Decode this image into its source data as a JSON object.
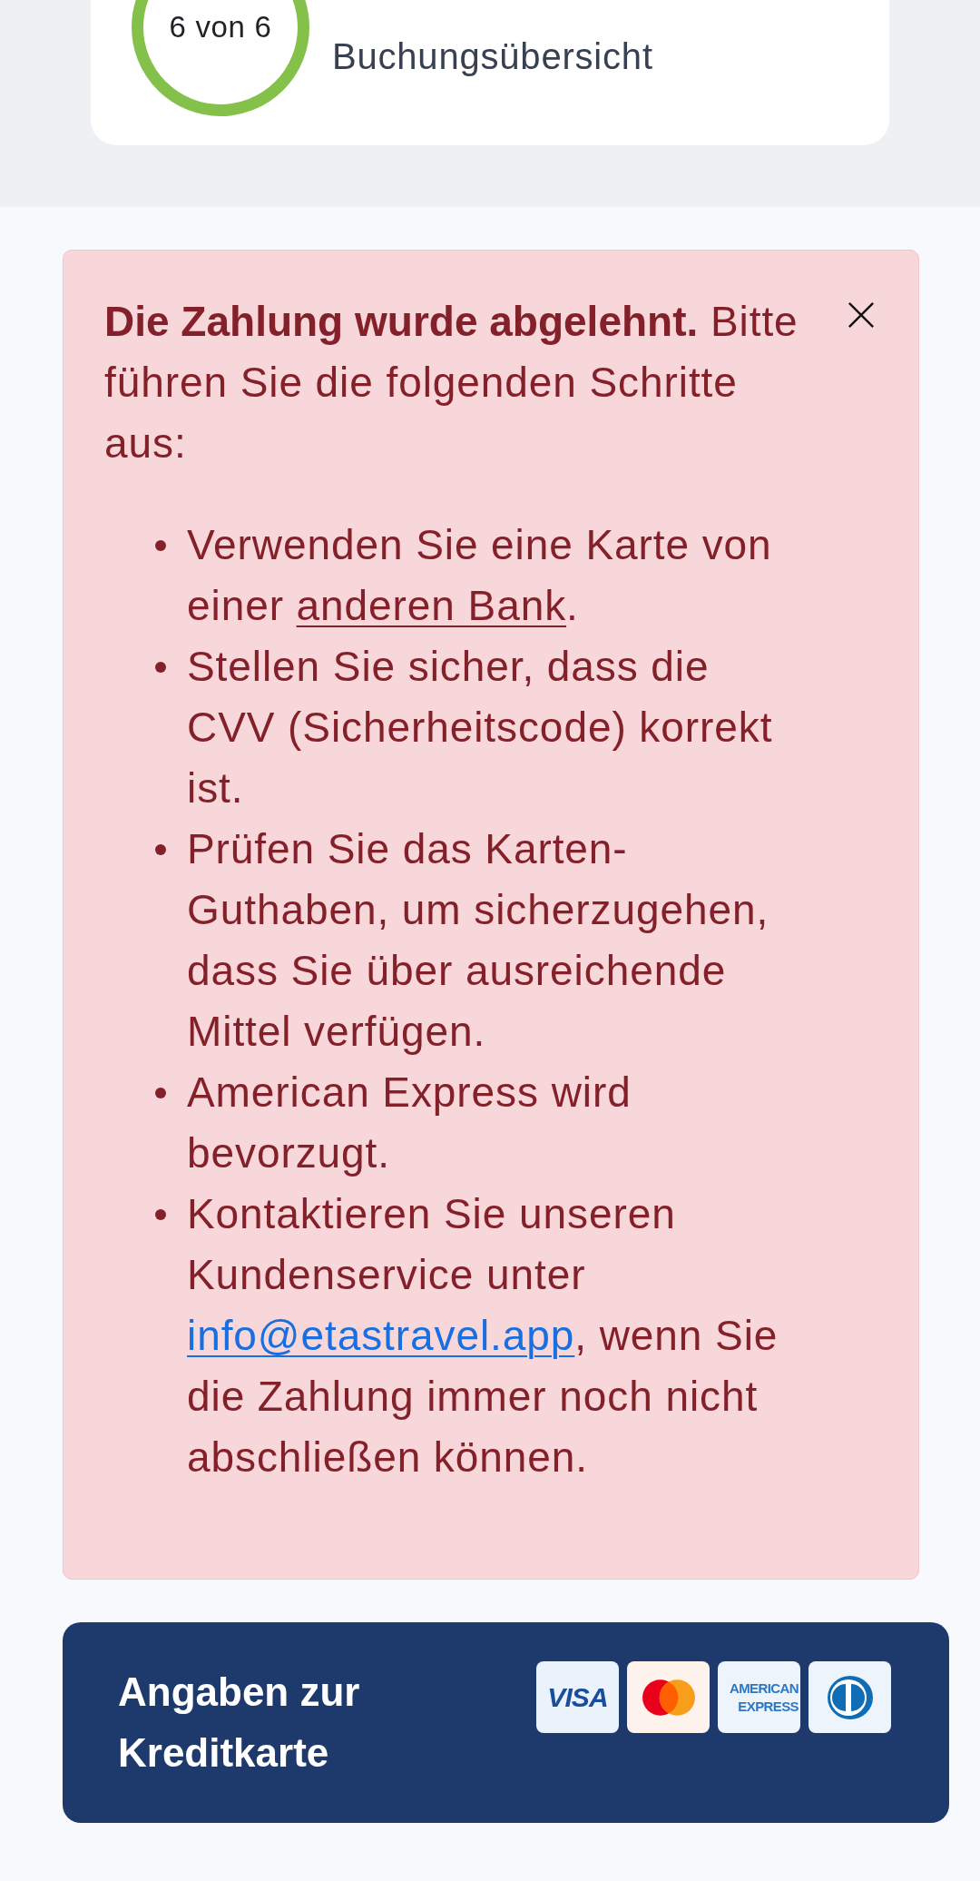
{
  "header": {
    "progress": {
      "label": "6 von 6"
    },
    "subtitle": "Buchungsübersicht"
  },
  "alert": {
    "kind": "error",
    "dismissible": true,
    "message": "**Die Zahlung wurde abgelehnt.** Bitte führen Sie die folgenden Schritte aus:",
    "steps": [
      {
        "segments": [
          {
            "kind": "text",
            "text": "Verwenden Sie eine Karte von einer "
          },
          {
            "kind": "link",
            "text": "anderen Bank"
          },
          {
            "kind": "text",
            "text": "."
          }
        ]
      },
      {
        "segments": [
          {
            "kind": "text",
            "text": "Stellen Sie sicher, dass die CVV (Sicherheitscode) korrekt ist."
          }
        ]
      },
      {
        "segments": [
          {
            "kind": "text",
            "text": "Prüfen Sie das Karten-Guthaben, um sicherzugehen, dass Sie über ausreichende Mittel verfügen."
          }
        ]
      },
      {
        "segments": [
          {
            "kind": "text",
            "text": "American Express wird bevorzugt."
          }
        ]
      },
      {
        "segments": [
          {
            "kind": "text",
            "text": "Kontaktieren Sie unseren Kundenservice unter "
          },
          {
            "kind": "email_link",
            "text": "info@etastravel.app"
          },
          {
            "kind": "text",
            "text": ", wenn Sie die Zahlung immer noch nicht abschließen können."
          }
        ]
      }
    ]
  },
  "credit_card_panel": {
    "title": "Angaben zur Kreditkarte",
    "logos": [
      {
        "kind": "visa",
        "text": "VISA"
      },
      {
        "kind": "mastercard"
      },
      {
        "kind": "amex",
        "text": "AMERICAN EXPRESS"
      },
      {
        "kind": "diners"
      }
    ]
  }
}
